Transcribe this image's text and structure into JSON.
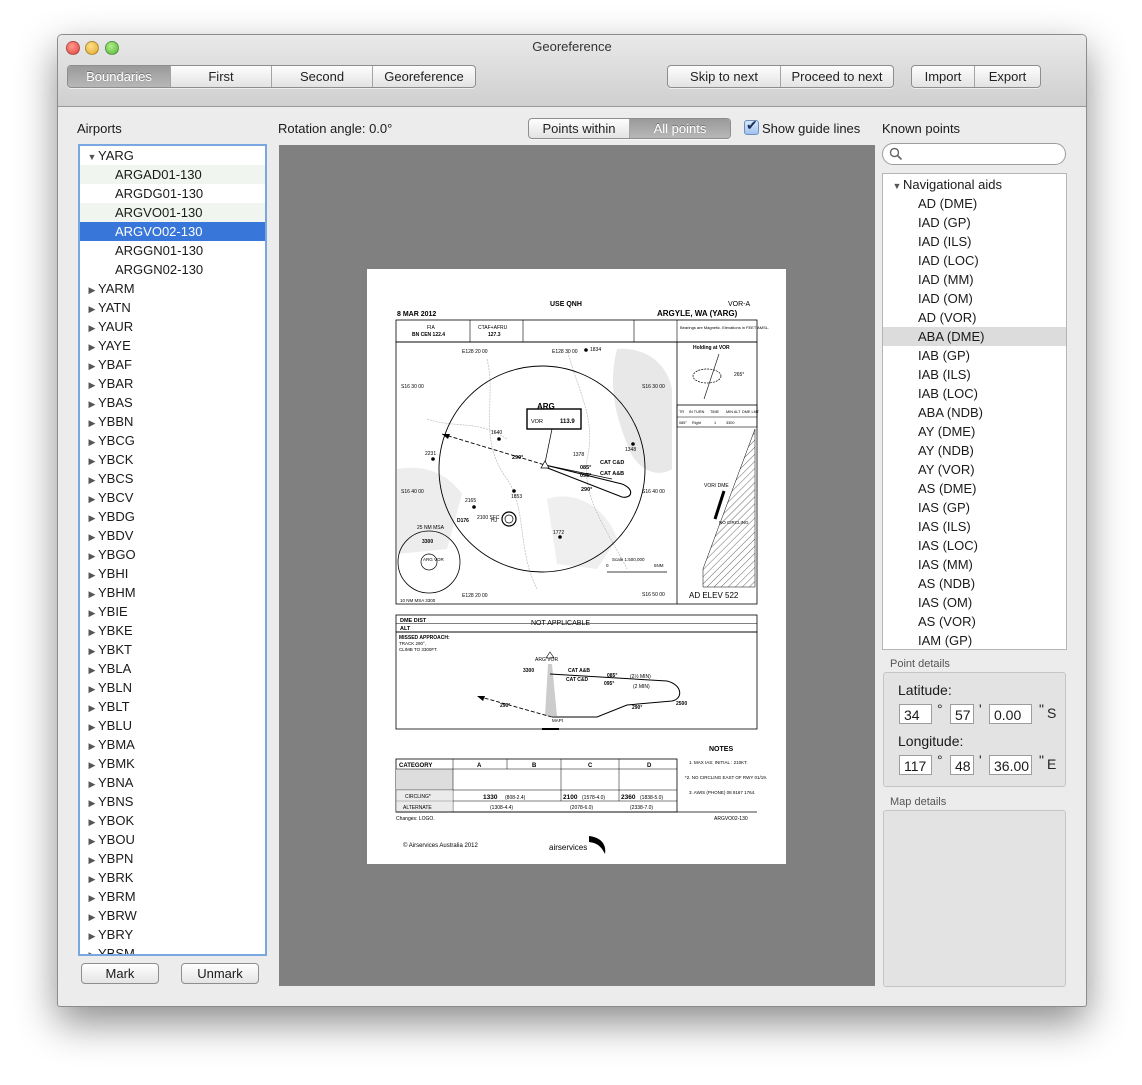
{
  "window": {
    "title": "Georeference"
  },
  "toolbar": {
    "steps": [
      "Boundaries",
      "First",
      "Second",
      "Georeference"
    ],
    "selected_step": "Boundaries",
    "skip_label": "Skip to next",
    "proceed_label": "Proceed to next",
    "import_label": "Import",
    "export_label": "Export"
  },
  "airports": {
    "label": "Airports",
    "tree": [
      {
        "name": "YARG",
        "expanded": true,
        "children": [
          {
            "name": "ARGAD01-130",
            "alt": true
          },
          {
            "name": "ARGDG01-130",
            "alt": false
          },
          {
            "name": "ARGVO01-130",
            "alt": true
          },
          {
            "name": "ARGVO02-130",
            "selected": true
          },
          {
            "name": "ARGGN01-130",
            "alt": false
          },
          {
            "name": "ARGGN02-130",
            "alt": false
          }
        ]
      },
      {
        "name": "YARM"
      },
      {
        "name": "YATN"
      },
      {
        "name": "YAUR"
      },
      {
        "name": "YAYE"
      },
      {
        "name": "YBAF"
      },
      {
        "name": "YBAR"
      },
      {
        "name": "YBAS"
      },
      {
        "name": "YBBN"
      },
      {
        "name": "YBCG"
      },
      {
        "name": "YBCK"
      },
      {
        "name": "YBCS"
      },
      {
        "name": "YBCV"
      },
      {
        "name": "YBDG"
      },
      {
        "name": "YBDV"
      },
      {
        "name": "YBGO"
      },
      {
        "name": "YBHI"
      },
      {
        "name": "YBHM"
      },
      {
        "name": "YBIE"
      },
      {
        "name": "YBKE"
      },
      {
        "name": "YBKT"
      },
      {
        "name": "YBLA"
      },
      {
        "name": "YBLN"
      },
      {
        "name": "YBLT"
      },
      {
        "name": "YBLU"
      },
      {
        "name": "YBMA"
      },
      {
        "name": "YBMK"
      },
      {
        "name": "YBNA"
      },
      {
        "name": "YBNS"
      },
      {
        "name": "YBOK"
      },
      {
        "name": "YBOU"
      },
      {
        "name": "YBPN"
      },
      {
        "name": "YBRK"
      },
      {
        "name": "YBRM"
      },
      {
        "name": "YBRW"
      },
      {
        "name": "YBRY"
      },
      {
        "name": "YBSM"
      }
    ],
    "mark_label": "Mark",
    "unmark_label": "Unmark"
  },
  "map": {
    "rotation_label": "Rotation angle: 0.0°",
    "points_within_label": "Points within",
    "all_points_label": "All points",
    "show_guide_lines_label": "Show guide lines",
    "show_guide_lines_checked": true
  },
  "chart": {
    "use_qnh": "USE QNH",
    "date": "8 MAR 2012",
    "type": "VOR-A",
    "airport": "ARGYLE, WA (YARG)",
    "fia_label": "FIA",
    "fia_value": "BN CEN 122.4",
    "ctaf_label": "CTAF+AFRU",
    "ctaf_value": "127.3",
    "bearings_note": "Bearings are Magnetic. Elevations in FEET AMSL.",
    "holding_title": "Holding at VOR",
    "hold_inbound": "265°",
    "hold_table_headers": [
      "TR",
      "IN TURN",
      "TIME",
      "MIN ALT",
      "DME LMT"
    ],
    "hold_table_row": [
      "085°",
      "Right",
      "1",
      "3300",
      ""
    ],
    "grid_e12820": "E128 20 00",
    "grid_e12830": "E128 30 00",
    "grid_s1630": "S16 30 00",
    "grid_s1640": "S16 40 00",
    "grid_s1650": "S16 50 00",
    "spot_1834": "1834",
    "spot_1640": "1640",
    "spot_2231": "2231",
    "spot_1348": "1348",
    "spot_1378": "1378",
    "spot_1853": "1853",
    "spot_2165": "2165",
    "spot_1772": "1772",
    "vor_ident": "ARG",
    "vor_freq_label": "VOR",
    "vor_freq": "113.9",
    "track_290": "290°",
    "track_085": "085°",
    "track_095": "095°",
    "cat_cd": "CAT C&D",
    "cat_ab": "CAT A&B",
    "danger_area": "D176",
    "danger_alt": "2100 SFC",
    "danger_hj": "HJ",
    "msa_label": "25 NM MSA",
    "msa_value": "3300",
    "msa_vor": "ARG VOR",
    "msa_10": "10 NM MSA 3300",
    "scale_label": "Scale 1:500,000",
    "scale_0": "0",
    "scale_5": "5NM",
    "vor_dme": "VOR/ DME",
    "no_circling": "NO CIRCLING",
    "ad_elev": "AD ELEV 522",
    "dme_dist": "DME DIST",
    "alt": "ALT",
    "not_applicable": "NOT APPLICABLE",
    "missed_title": "MISSED APPROACH:",
    "missed_track": "TRACK 290°,",
    "missed_climb": "CLIMB TO 3300FT.",
    "profile_vor": "ARG VOR",
    "profile_3300": "3300",
    "profile_2500": "2500",
    "profile_map": "MAPt",
    "profile_min1": "(2½ MIN)",
    "profile_min2": "(2 MIN)",
    "notes_title": "NOTES",
    "note1": "1. MAX IAS: INITIAL : 210KT.",
    "note2": "*2. NO CIRCLING EAST OF RWY 01/19.",
    "note3": "3. AWIS (PHONE) 08 9167 1764.",
    "cat_label": "CATEGORY",
    "cat_a": "A",
    "cat_b": "B",
    "cat_c": "C",
    "cat_d": "D",
    "circling_label": "CIRCLING*",
    "alternate_label": "ALTERNATE",
    "circ_ab": "1330",
    "circ_ab_sub": "(808-2.4)",
    "circ_c": "2100",
    "circ_c_sub": "(1578-4.0)",
    "circ_d": "2360",
    "circ_d_sub": "(1838-5.0)",
    "alt_ab": "(1308-4.4)",
    "alt_c": "(2078-6.0)",
    "alt_d": "(2338-7.0)",
    "changes": "Changes: LOGO.",
    "doc_id": "ARGVO02-130",
    "copyright": "© Airservices Australia 2012",
    "logo": "airservices"
  },
  "known_points": {
    "label": "Known points",
    "group": "Navigational aids",
    "items": [
      "AD (DME)",
      "IAD (GP)",
      "IAD (ILS)",
      "IAD (LOC)",
      "IAD (MM)",
      "IAD (OM)",
      "AD (VOR)",
      "ABA (DME)",
      "IAB (GP)",
      "IAB (ILS)",
      "IAB (LOC)",
      "ABA (NDB)",
      "AY (DME)",
      "AY (NDB)",
      "AY (VOR)",
      "AS (DME)",
      "IAS (GP)",
      "IAS (ILS)",
      "IAS (LOC)",
      "IAS (MM)",
      "AS (NDB)",
      "IAS (OM)",
      "AS (VOR)",
      "IAM (GP)"
    ],
    "highlighted": "ABA (DME)"
  },
  "point_details": {
    "label": "Point details",
    "latitude_label": "Latitude:",
    "lat_deg": "34",
    "lat_min": "57",
    "lat_sec": "0.00",
    "lat_hemi": "S",
    "longitude_label": "Longitude:",
    "lon_deg": "117",
    "lon_min": "48",
    "lon_sec": "36.00",
    "lon_hemi": "E",
    "deg_symbol": "°",
    "min_symbol": "'",
    "sec_symbol": "\""
  },
  "map_details": {
    "label": "Map details"
  }
}
